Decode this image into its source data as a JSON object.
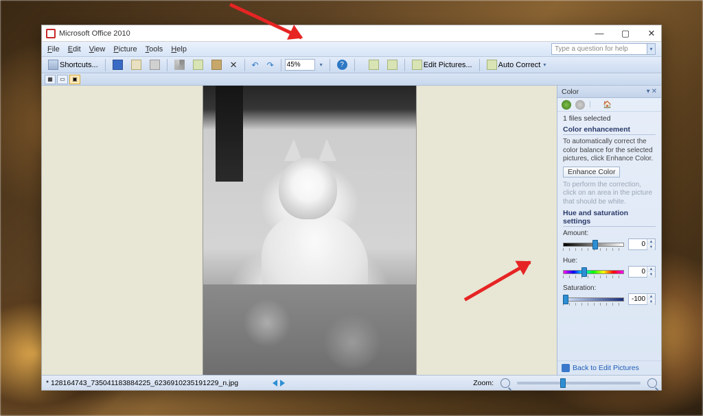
{
  "window": {
    "title": "Microsoft Office 2010",
    "help_placeholder": "Type a question for help"
  },
  "menu": {
    "file": "File",
    "edit": "Edit",
    "view": "View",
    "picture": "Picture",
    "tools": "Tools",
    "help": "Help"
  },
  "toolbar": {
    "shortcuts": "Shortcuts...",
    "zoom": "45%",
    "edit_pictures": "Edit Pictures...",
    "auto_correct": "Auto Correct"
  },
  "panel": {
    "title": "Color",
    "files_selected": "1 files selected",
    "section1": "Color enhancement",
    "hint1": "To automatically correct the color balance for the selected pictures, click Enhance Color.",
    "enhance_btn": "Enhance Color",
    "hint2": "To perform the correction, click on an area in the picture that should be white.",
    "section2": "Hue and saturation settings",
    "amount_label": "Amount:",
    "amount_value": "0",
    "hue_label": "Hue:",
    "hue_value": "0",
    "sat_label": "Saturation:",
    "sat_value": "-100",
    "back": "Back to Edit Pictures"
  },
  "status": {
    "filename": "* 128164743_735041183884225_6236910235191229_n.jpg",
    "zoom_label": "Zoom:"
  }
}
